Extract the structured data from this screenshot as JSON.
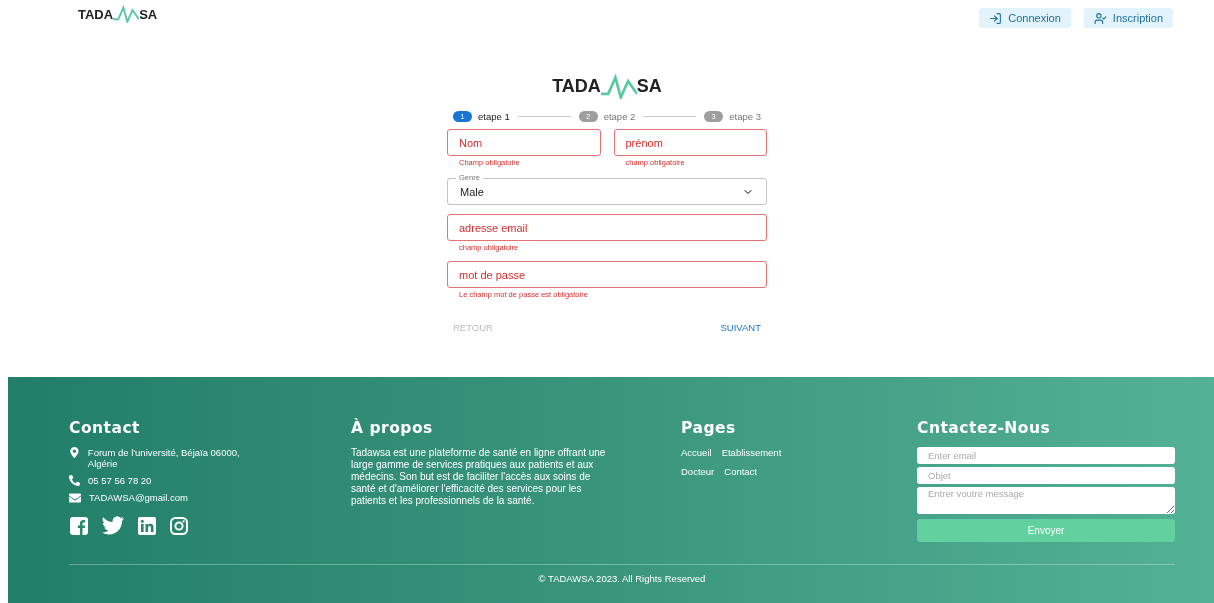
{
  "header": {
    "logo": {
      "left": "TADA",
      "right": "SA"
    },
    "buttons": [
      {
        "kind": "login",
        "label": "Connexion"
      },
      {
        "kind": "signup",
        "label": "Inscription"
      }
    ]
  },
  "form": {
    "logo": {
      "left": "TADA",
      "right": "SA"
    },
    "steps": [
      {
        "number": "1",
        "label": "etape 1",
        "selected": true
      },
      {
        "number": "2",
        "label": "etape 2",
        "selected": false
      },
      {
        "number": "3",
        "label": "etape 3",
        "selected": false
      }
    ],
    "name_fields": [
      {
        "placeholder": "Nom",
        "error": true,
        "helper": "Champ obligatoire"
      },
      {
        "placeholder": "prénom",
        "error": true,
        "helper": "champ obligatoire"
      }
    ],
    "gender": {
      "label": "Genre",
      "value": "Male"
    },
    "fields": [
      {
        "placeholder": "adresse email",
        "error": true,
        "helper": "champ obligatoire"
      },
      {
        "placeholder": "mot de passe",
        "error": true,
        "helper": "Le champ mot de passe est obligatoire"
      }
    ],
    "back": {
      "label": "RETOUR",
      "disabled": true
    },
    "next": {
      "label": "SUIVANT"
    }
  },
  "footer": {
    "contact": {
      "title": "Contact",
      "items": [
        {
          "kind": "address",
          "text": "Forum de l'université, Béjaïa 06000, Algérie"
        },
        {
          "kind": "phone",
          "text": "05 57 56 78 20"
        },
        {
          "kind": "email",
          "text": "TADAWSA@gmail.com"
        }
      ],
      "social": [
        {
          "kind": "facebook"
        },
        {
          "kind": "twitter"
        },
        {
          "kind": "linkedin"
        },
        {
          "kind": "instagram"
        }
      ]
    },
    "about": {
      "title": "À propos",
      "text": "Tadawsa est une plateforme de santé en ligne offrant une large gamme de services pratiques aux patients et aux médecins. Son but est de faciliter l'accès aux soins de santé et d'améliorer l'efficacité des services pour les patients et les professionnels de la santé."
    },
    "pages": {
      "title": "Pages",
      "rows": [
        {
          "links": [
            "Accueil",
            "Etablissement"
          ]
        },
        {
          "links": [
            "Docteur",
            "Contact"
          ]
        }
      ]
    },
    "message": {
      "title": "Cntactez-Nous",
      "email_placeholder": "Enter email",
      "subject_placeholder": "Objet",
      "message_placeholder": "Entrer voutre message",
      "button": "Envoyer"
    },
    "copyright": "© TADAWSA 2023. All Rights Reserved"
  }
}
